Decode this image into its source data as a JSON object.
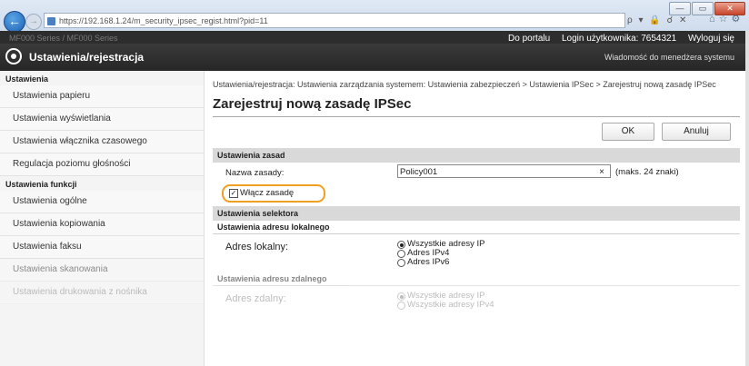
{
  "browser": {
    "url": "https://192.168.1.24/m_security_ipsec_regist.html?pid=11",
    "addr_controls": "ρ ▾ 🔒 ☌ ✕",
    "window_buttons": [
      "—",
      "▭",
      "✕"
    ],
    "back_icon": "back-arrow-icon",
    "forward_icon": "forward-arrow-icon"
  },
  "header": {
    "model_text": "MF000 Series / MF000 Series",
    "links": [
      "Do portalu",
      "Login użytkownika: 7654321",
      "Wyloguj się"
    ],
    "app_title": "Ustawienia/rejestracja",
    "manager_msg": "Wiadomość do menedżera systemu",
    "accent": "#2d2d2d"
  },
  "sidebar": {
    "group1_title": "Ustawienia",
    "group1_items": [
      "Ustawienia papieru",
      "Ustawienia wyświetlania",
      "Ustawienia włącznika czasowego",
      "Regulacja poziomu głośności"
    ],
    "group2_title": "Ustawienia funkcji",
    "group2_items": [
      "Ustawienia ogólne",
      "Ustawienia kopiowania",
      "Ustawienia faksu",
      "Ustawienia skanowania",
      "Ustawienia drukowania z nośnika"
    ]
  },
  "main": {
    "breadcrumb": "Ustawienia/rejestracja: Ustawienia zarządzania systemem: Ustawienia zabezpieczeń > Ustawienia IPSec > Zarejestruj nową zasadę IPSec",
    "title": "Zarejestruj nową zasadę IPSec",
    "ok_label": "OK",
    "cancel_label": "Anuluj",
    "policy_section": "Ustawienia zasad",
    "policy_name_label": "Nazwa zasady:",
    "policy_name_value": "Policy001",
    "policy_name_hint": "(maks. 24 znaki)",
    "enable_policy_label": "Włącz zasadę",
    "enable_policy_checked": true,
    "selector_section": "Ustawienia selektora",
    "local_addr_head": "Ustawienia adresu lokalnego",
    "local_addr_label": "Adres lokalny:",
    "local_options": [
      "Wszystkie adresy IP",
      "Adres IPv4",
      "Adres IPv6"
    ],
    "local_selected": 0,
    "remote_addr_head": "Ustawienia adresu zdalnego",
    "remote_addr_label": "Adres zdalny:",
    "remote_options": [
      "Wszystkie adresy IP",
      "Wszystkie adresy IPv4"
    ]
  }
}
